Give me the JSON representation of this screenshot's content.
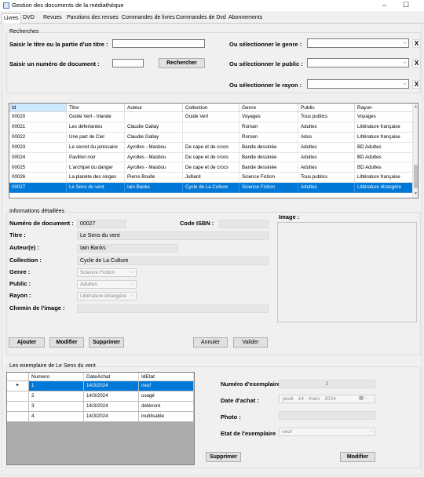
{
  "window": {
    "title": "Gestion des documents de la médiathèque",
    "minimize": "–",
    "maximize": "☐"
  },
  "tabs": [
    "Livres",
    "DVD",
    "Revues",
    "Parutions des revues",
    "Commandes de livres",
    "Commandes de Dvd",
    "Abonnements"
  ],
  "search": {
    "group_title": "Recherches",
    "title_label": "Saisir le titre ou la partie d'un titre :",
    "doc_label": "Saisir un numéro de document :",
    "search_button": "Rechercher",
    "genre_label": "Ou sélectionner le genre :",
    "public_label": "Ou sélectionner le public :",
    "rayon_label": "Ou sélectionner le rayon :",
    "clear": "X"
  },
  "books_table": {
    "columns": [
      "Id",
      "Titre",
      "Auteur",
      "Collection",
      "Genre",
      "Public",
      "Rayon"
    ],
    "rows": [
      [
        "00020",
        "Guide Vert - Irlande",
        "",
        "Guide Vert",
        "Voyages",
        "Tous publics",
        "Voyages"
      ],
      [
        "00021",
        "Les déferlantes",
        "Claudie Gallay",
        "",
        "Roman",
        "Adultes",
        "Littérature française"
      ],
      [
        "00022",
        "Une part de Ciel",
        "Claudie Gallay",
        "",
        "Roman",
        "Ados",
        "Littérature française"
      ],
      [
        "00023",
        "Le secret du janissaire",
        "Ayrolles - Masbou",
        "De cape et de crocs",
        "Bande dessinée",
        "Adultes",
        "BD Adultes"
      ],
      [
        "00024",
        "Pavillon noir",
        "Ayrolles - Masbou",
        "De cape et de crocs",
        "Bande dessinée",
        "Adultes",
        "BD Adultes"
      ],
      [
        "00025",
        "L'archipel du danger",
        "Ayrolles - Masbou",
        "De cape et de crocs",
        "Bande dessinée",
        "Adultes",
        "BD Adultes"
      ],
      [
        "00026",
        "La planète des singes",
        "Pierre Boulle",
        "Julliard",
        "Science Fiction",
        "Tous publics",
        "Littérature française"
      ],
      [
        "00027",
        "Le Sens du vent",
        "Iain Banks",
        "Cycle de La Culture",
        "Science Fiction",
        "Adultes",
        "Littérature étrangère"
      ]
    ],
    "selected_index": 7
  },
  "details": {
    "group_title": "Informations détaillées",
    "numero_label": "Numéro de document :",
    "numero_value": "00027",
    "isbn_label": "Code ISBN :",
    "isbn_value": "",
    "titre_label": "Titre :",
    "titre_value": "Le Sens du vent",
    "auteur_label": "Auteur(e) :",
    "auteur_value": "Iain Banks",
    "collection_label": "Collection :",
    "collection_value": "Cycle de La Culture",
    "genre_label": "Genre :",
    "genre_value": "Science Fiction",
    "public_label": "Public :",
    "public_value": "Adultes",
    "rayon_label": "Rayon :",
    "rayon_value": "Littérature étrangère",
    "chemin_label": "Chemin de l'image :",
    "image_label": "Image :",
    "buttons": {
      "ajouter": "Ajouter",
      "modifier": "Modifier",
      "supprimer": "Supprimer",
      "annuler": "Annuler",
      "valider": "Valider"
    }
  },
  "exemplaires": {
    "group_title": "Les exemplaire de Le Sens du vent",
    "columns": [
      "Numero",
      "DateAchat",
      "IdEtat"
    ],
    "rows": [
      [
        "1",
        "14/3/2024",
        "neuf"
      ],
      [
        "2",
        "14/3/2024",
        "usagé"
      ],
      [
        "3",
        "14/3/2024",
        "détérioré"
      ],
      [
        "4",
        "14/3/2024",
        "inutilisable"
      ]
    ],
    "selected_index": 0,
    "row_marker": "▸",
    "numero_label": "Numéro d'exemplaire :",
    "numero_value": "1",
    "date_label": "Date d'achat :",
    "date_day": "jeudi",
    "date_num": "14",
    "date_month": "mars",
    "date_year": "2024",
    "photo_label": "Photo :",
    "etat_label": "Etat de l'exemplaire",
    "etat_value": "neuf",
    "supprimer": "Supprimer",
    "modifier": "Modifier"
  }
}
